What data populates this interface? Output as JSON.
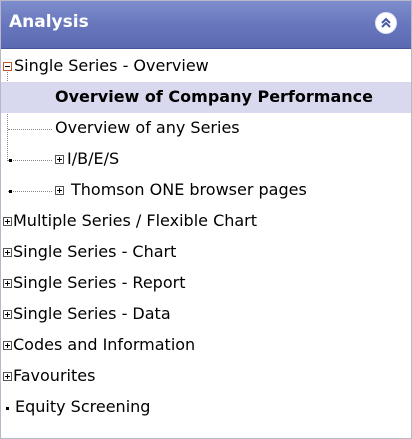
{
  "header": {
    "title": "Analysis",
    "collapse_icon": "double-chevron-up-icon"
  },
  "tree": {
    "single_series_overview": "Single Series - Overview",
    "overview_company_performance": "Overview of Company Performance",
    "overview_any_series": "Overview of any Series",
    "ibes": "I/B/E/S",
    "thomson_one": "Thomson ONE browser pages",
    "multiple_series": "Multiple Series / Flexible Chart",
    "single_series_chart": "Single Series - Chart",
    "single_series_report": "Single Series - Report",
    "single_series_data": "Single Series - Data",
    "codes_information": "Codes and Information",
    "favourites": "Favourites",
    "equity_screening": "Equity Screening"
  },
  "colors": {
    "header": "#6877bd",
    "selected_row": "#d8d8ee"
  }
}
